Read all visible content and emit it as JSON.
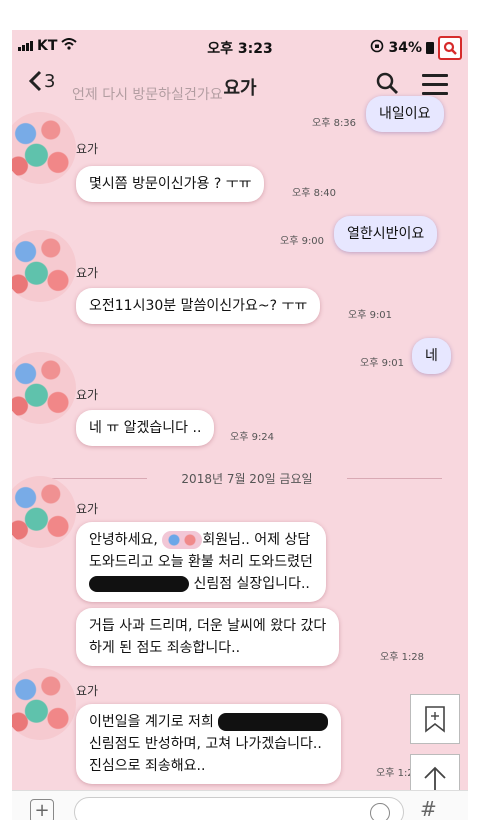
{
  "status": {
    "carrier": "KT",
    "time": "오후 3:23",
    "battery": "34%"
  },
  "header": {
    "back_count": "3",
    "title": "요가",
    "ghost_text": "언제 다시 방문하실건가요"
  },
  "messages": [
    {
      "kind": "out",
      "text": "내일이요",
      "time": "오후 8:36"
    },
    {
      "kind": "in",
      "sender": "요가",
      "text": "몇시쯤 방문이신가용 ? ㅜㅠ",
      "time": "오후 8:40"
    },
    {
      "kind": "out",
      "text": "열한시반이요",
      "time": "오후 9:00"
    },
    {
      "kind": "in",
      "sender": "요가",
      "text": "오전11시30분 말씀이신가요~? ㅜㅠ",
      "time": "오후 9:01"
    },
    {
      "kind": "out",
      "text": "네",
      "time": "오후 9:01"
    },
    {
      "kind": "in",
      "sender": "요가",
      "text": "네 ㅠ 알겠습니다 ..",
      "time": "오후 9:24"
    }
  ],
  "date_separator": "2018년 7월 20일 금요일",
  "later": {
    "sender": "요가",
    "m1_l1a": "안녕하세요,",
    "m1_l1b": "회원님.. 어제 상담",
    "m1_l2": "도와드리고 오늘 환불 처리 도와드렸던",
    "m1_l3": "신림점 실장입니다..",
    "m2_l1": "거듭 사과 드리며, 더운 날씨에 왔다 갔다",
    "m2_l2": "하게 된 점도 죄송합니다..",
    "m2_time": "오후 1:28",
    "m3_l1": "이번일을 계기로 저희",
    "m3_l2": "신림점도 반성하며, 고쳐 나가겠습니다..",
    "m3_l3": "진심으로 죄송해요..",
    "m3_time": "오후 1:2"
  },
  "input": {
    "placeholder": ""
  }
}
